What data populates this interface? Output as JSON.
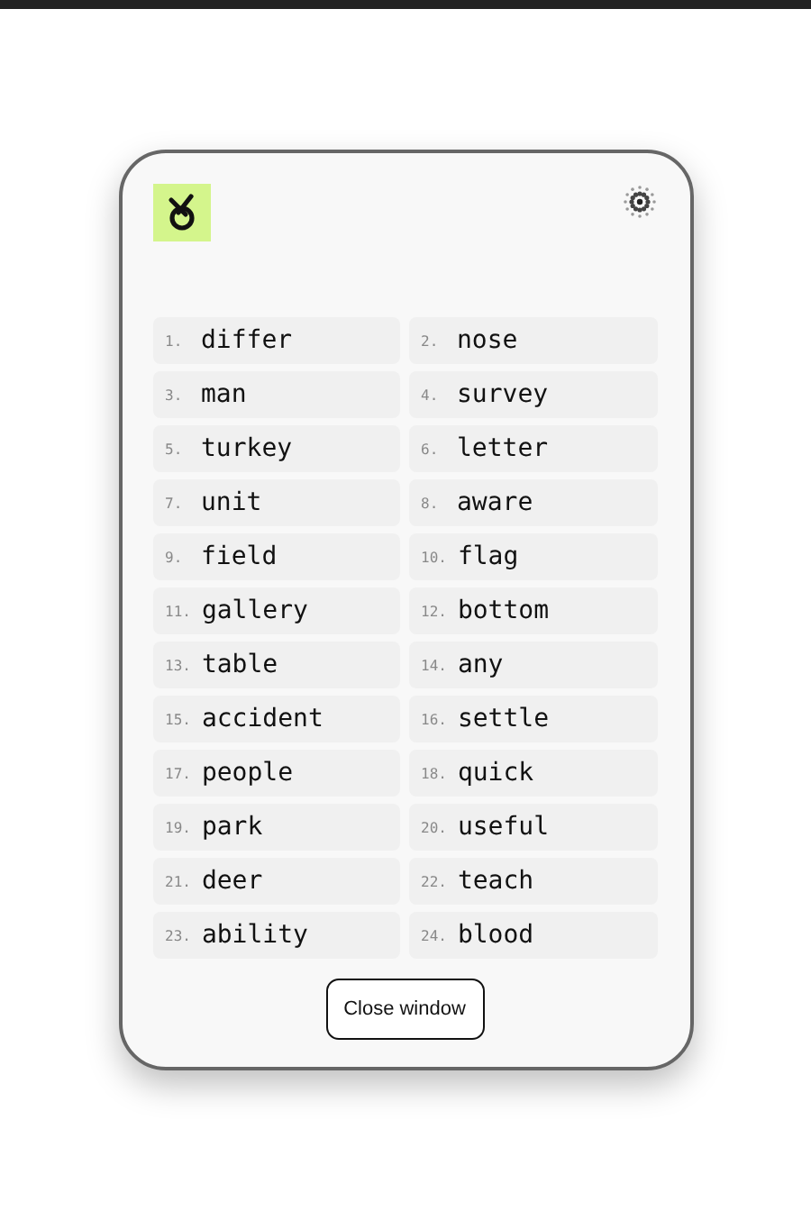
{
  "words": [
    {
      "number": "1.",
      "word": "differ"
    },
    {
      "number": "2.",
      "word": "nose"
    },
    {
      "number": "3.",
      "word": "man"
    },
    {
      "number": "4.",
      "word": "survey"
    },
    {
      "number": "5.",
      "word": "turkey"
    },
    {
      "number": "6.",
      "word": "letter"
    },
    {
      "number": "7.",
      "word": "unit"
    },
    {
      "number": "8.",
      "word": "aware"
    },
    {
      "number": "9.",
      "word": "field"
    },
    {
      "number": "10.",
      "word": "flag"
    },
    {
      "number": "11.",
      "word": "gallery"
    },
    {
      "number": "12.",
      "word": "bottom"
    },
    {
      "number": "13.",
      "word": "table"
    },
    {
      "number": "14.",
      "word": "any"
    },
    {
      "number": "15.",
      "word": "accident"
    },
    {
      "number": "16.",
      "word": "settle"
    },
    {
      "number": "17.",
      "word": "people"
    },
    {
      "number": "18.",
      "word": "quick"
    },
    {
      "number": "19.",
      "word": "park"
    },
    {
      "number": "20.",
      "word": "useful"
    },
    {
      "number": "21.",
      "word": "deer"
    },
    {
      "number": "22.",
      "word": "teach"
    },
    {
      "number": "23.",
      "word": "ability"
    },
    {
      "number": "24.",
      "word": "blood"
    }
  ],
  "close_button": "Close window"
}
